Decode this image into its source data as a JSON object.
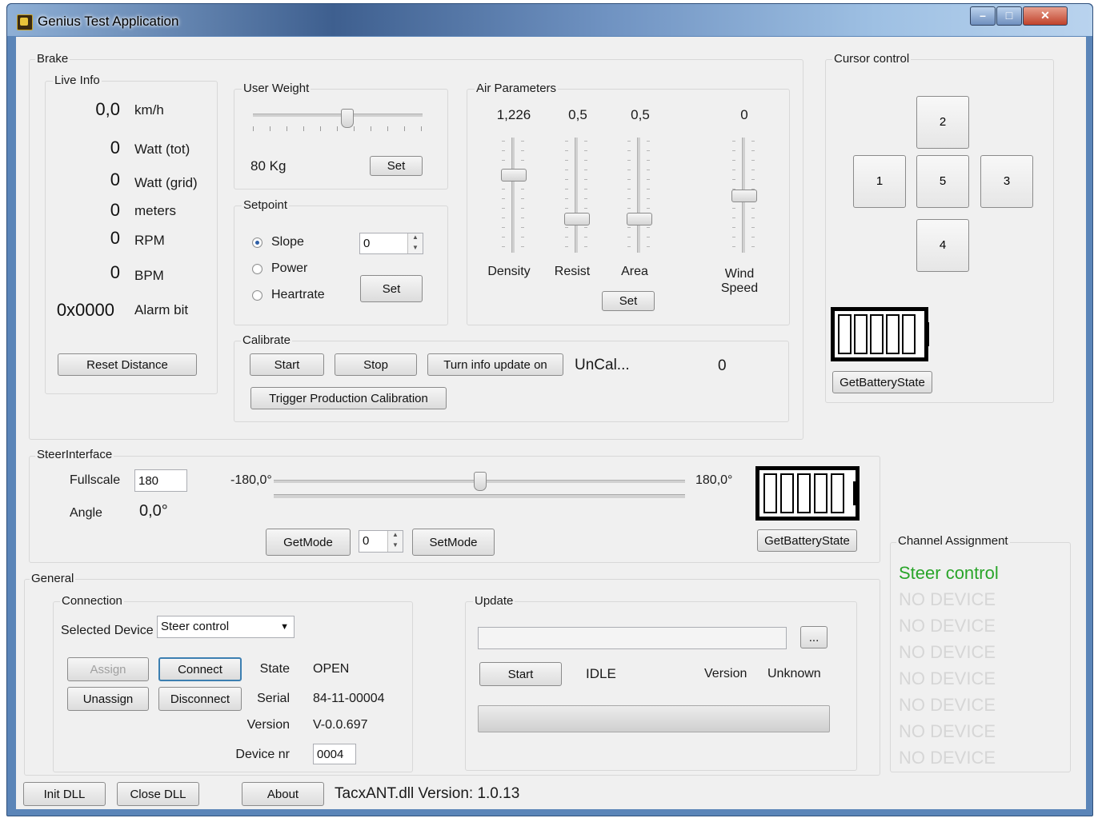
{
  "window": {
    "title": "Genius Test Application"
  },
  "brake": {
    "group_label": "Brake",
    "live_info": {
      "label": "Live Info",
      "rows": [
        {
          "value": "0,0",
          "unit": "km/h"
        },
        {
          "value": "0",
          "unit": "Watt (tot)"
        },
        {
          "value": "0",
          "unit": "Watt (grid)"
        },
        {
          "value": "0",
          "unit": "meters"
        },
        {
          "value": "0",
          "unit": "RPM"
        },
        {
          "value": "0",
          "unit": "BPM"
        },
        {
          "value": "0x0000",
          "unit": "Alarm bit"
        }
      ],
      "reset_label": "Reset Distance"
    },
    "user_weight": {
      "label": "User Weight",
      "value": "80 Kg",
      "set_label": "Set",
      "slider_fraction": 0.55
    },
    "setpoint": {
      "label": "Setpoint",
      "options": [
        "Slope",
        "Power",
        "Heartrate"
      ],
      "selected": "Slope",
      "value": "0",
      "set_label": "Set"
    },
    "air": {
      "label": "Air Parameters",
      "params": [
        {
          "value": "1,226",
          "name": "Density",
          "level": 0.7
        },
        {
          "value": "0,5",
          "name": "Resist",
          "level": 0.28
        },
        {
          "value": "0,5",
          "name": "Area",
          "level": 0.28
        },
        {
          "value": "0",
          "name": "Wind",
          "name2": "Speed",
          "level": 0.5
        }
      ],
      "set_label": "Set"
    },
    "calibrate": {
      "label": "Calibrate",
      "start_label": "Start",
      "stop_label": "Stop",
      "info_label": "Turn info update on",
      "status": "UnCal...",
      "value": "0",
      "trigger_label": "Trigger Production Calibration"
    }
  },
  "cursor": {
    "label": "Cursor control",
    "buttons": {
      "up": "2",
      "left": "1",
      "center": "5",
      "right": "3",
      "down": "4"
    },
    "battery_label": "GetBatteryState"
  },
  "steer": {
    "label": "SteerInterface",
    "fullscale_label": "Fullscale",
    "fullscale_value": "180",
    "angle_label": "Angle",
    "angle_value": "0,0°",
    "min_label": "-180,0°",
    "max_label": "180,0°",
    "slider_fraction": 0.5,
    "getmode_label": "GetMode",
    "mode_value": "0",
    "setmode_label": "SetMode",
    "battery_label": "GetBatteryState"
  },
  "general": {
    "label": "General",
    "connection": {
      "label": "Connection",
      "selected_device_label": "Selected Device",
      "selected_device_value": "Steer control",
      "assign_label": "Assign",
      "connect_label": "Connect",
      "unassign_label": "Unassign",
      "disconnect_label": "Disconnect",
      "state_label": "State",
      "state_value": "OPEN",
      "serial_label": "Serial",
      "serial_value": "84-11-00004",
      "version_label": "Version",
      "version_value": "V-0.0.697",
      "device_nr_label": "Device nr",
      "device_nr_value": "0004"
    },
    "update": {
      "label": "Update",
      "browse_label": "...",
      "start_label": "Start",
      "status": "IDLE",
      "version_label": "Version",
      "version_value": "Unknown"
    }
  },
  "channels": {
    "label": "Channel Assignment",
    "items": [
      "Steer control",
      "NO DEVICE",
      "NO DEVICE",
      "NO DEVICE",
      "NO DEVICE",
      "NO DEVICE",
      "NO DEVICE",
      "NO DEVICE"
    ],
    "active_color": "#2aa52a",
    "inactive_color": "#d6d6d6"
  },
  "footer": {
    "init_label": "Init DLL",
    "close_label": "Close DLL",
    "about_label": "About",
    "dll_version": "TacxANT.dll Version: 1.0.13"
  }
}
